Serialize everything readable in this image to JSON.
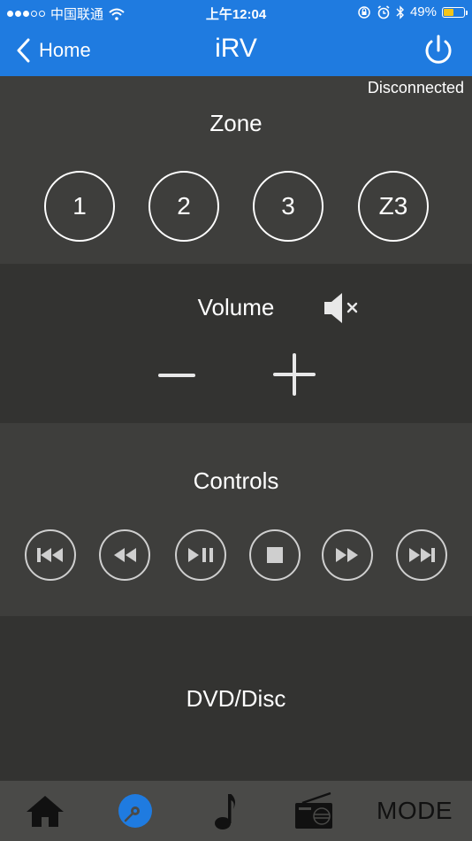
{
  "status_bar": {
    "carrier": "中国联通",
    "time": "上午12:04",
    "battery_percent": "49%",
    "battery_level": 0.49,
    "signal_bars": 3
  },
  "nav": {
    "back_label": "Home",
    "title": "iRV"
  },
  "connection_status": "Disconnected",
  "zone": {
    "title": "Zone",
    "buttons": [
      "1",
      "2",
      "3",
      "Z3"
    ]
  },
  "volume": {
    "title": "Volume"
  },
  "controls": {
    "title": "Controls",
    "buttons": [
      "skip-back-icon",
      "rewind-icon",
      "play-pause-icon",
      "stop-icon",
      "fast-forward-icon",
      "skip-forward-icon"
    ]
  },
  "source": {
    "title": "DVD/Disc"
  },
  "tabs": {
    "mode_label": "MODE",
    "active_tab": "disc"
  },
  "colors": {
    "header_blue": "#1f7be0",
    "battery_yellow": "#f5c518",
    "active_tab_blue": "#1f7be0"
  }
}
